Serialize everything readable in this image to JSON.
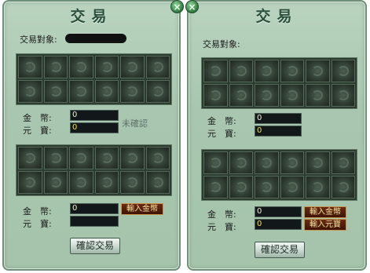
{
  "left_panel": {
    "title": "交易",
    "partner_label": "交易對象:",
    "partner_name_hidden": true,
    "other_offer": {
      "gold_label": "金　幣:",
      "gold_value": "0",
      "yuanbao_label": "元　寶:",
      "yuanbao_value": "0",
      "status": "未確認"
    },
    "my_offer": {
      "gold_label": "金　幣:",
      "gold_value": "0",
      "input_gold_button": "輸入金幣",
      "yuanbao_label": "元　寶:",
      "yuanbao_value": ""
    },
    "confirm_button": "確認交易"
  },
  "right_panel": {
    "title": "交易",
    "partner_label": "交易對象:",
    "other_offer": {
      "gold_label": "金　幣:",
      "gold_value": "0",
      "yuanbao_label": "元　寶:",
      "yuanbao_value": "0"
    },
    "my_offer": {
      "gold_label": "金　幣:",
      "gold_value": "0",
      "input_gold_button": "輸入金幣",
      "yuanbao_label": "元　寶:",
      "yuanbao_value": "0",
      "input_yuanbao_button": "輸入元寶"
    },
    "confirm_button": "確認交易"
  },
  "slot_grid": {
    "rows": 2,
    "cols": 6
  },
  "colors": {
    "panel_bg": "#a9c7b0",
    "panel_border": "#6f8f78",
    "title_text": "#2a4f3a",
    "field_bg": "#12181a",
    "yuanbao_value_text": "#f0e24a",
    "input_button_bg": "#3e1406",
    "input_button_text": "#f4e3a1"
  },
  "icons": {
    "close": "close-icon",
    "slot": "slot-swirl-icon"
  }
}
